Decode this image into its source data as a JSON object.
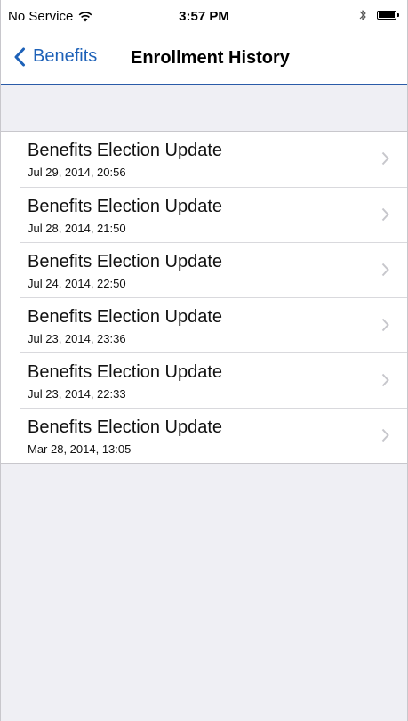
{
  "status_bar": {
    "carrier": "No Service",
    "time": "3:57 PM",
    "wifi_icon": "wifi-icon",
    "bluetooth_icon": "bluetooth-icon",
    "battery_icon": "battery-icon",
    "battery_level": 1.0
  },
  "nav": {
    "back_label": "Benefits",
    "title": "Enrollment History",
    "accent_color": "#1d61b8",
    "divider_color": "#2a5ba8"
  },
  "history": {
    "items": [
      {
        "title": "Benefits Election Update",
        "date": "Jul 29, 2014, 20:56"
      },
      {
        "title": "Benefits Election Update",
        "date": "Jul 28, 2014, 21:50"
      },
      {
        "title": "Benefits Election Update",
        "date": "Jul 24, 2014, 22:50"
      },
      {
        "title": "Benefits Election Update",
        "date": "Jul 23, 2014, 23:36"
      },
      {
        "title": "Benefits Election Update",
        "date": "Jul 23, 2014, 22:33"
      },
      {
        "title": "Benefits Election Update",
        "date": "Mar 28, 2014, 13:05"
      }
    ]
  },
  "colors": {
    "background": "#efeff4",
    "chevron": "#c7c7cc"
  }
}
